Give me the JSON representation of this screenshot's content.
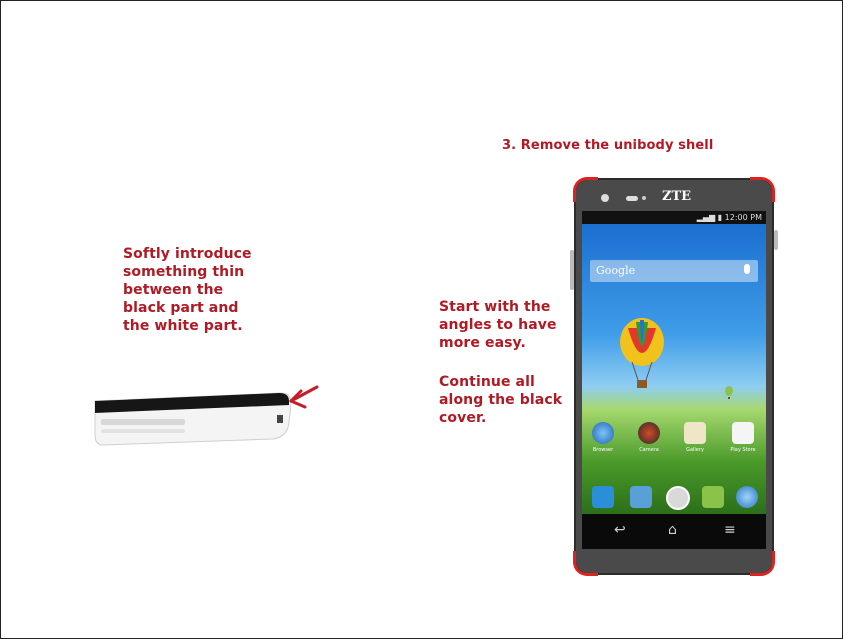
{
  "step_title": "3. Remove the unibody shell",
  "left_note": "Softly introduce\nsomething thin\nbetween the\nblack part and\nthe white part.",
  "right_note_1": "Start with the\nangles to have\nmore easy.",
  "right_note_2": "Continue all\nalong the black\ncover.",
  "phone": {
    "brand": "ZTE",
    "status_time": "12:00 PM",
    "search_label": "Google",
    "apps": [
      "Browser",
      "Camera",
      "Gallery",
      "Play Store"
    ]
  },
  "colors": {
    "annotation_red": "#b01a24",
    "corner_highlight": "#dd2222"
  }
}
